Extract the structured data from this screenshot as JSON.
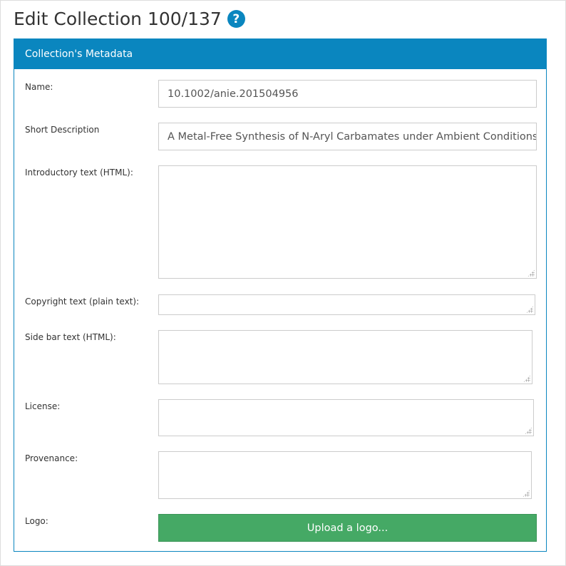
{
  "page": {
    "title": "Edit Collection 100/137",
    "help_icon": "?"
  },
  "panel": {
    "heading": "Collection's Metadata"
  },
  "form": {
    "name": {
      "label": "Name:",
      "value": "10.1002/anie.201504956"
    },
    "short_description": {
      "label": "Short Description",
      "value": "A Metal-Free Synthesis of N-Aryl Carbamates under Ambient Conditions"
    },
    "introductory_text": {
      "label": "Introductory text (HTML):",
      "value": ""
    },
    "copyright_text": {
      "label": "Copyright text (plain text):",
      "value": ""
    },
    "side_bar_text": {
      "label": "Side bar text (HTML):",
      "value": ""
    },
    "license": {
      "label": "License:",
      "value": ""
    },
    "provenance": {
      "label": "Provenance:",
      "value": ""
    },
    "logo": {
      "label": "Logo:",
      "button_label": "Upload a logo..."
    }
  },
  "colors": {
    "accent": "#0a86bf",
    "button": "#45a965",
    "border": "#cccccc"
  },
  "icons": [
    "help-icon",
    "resize-grip-icon"
  ]
}
